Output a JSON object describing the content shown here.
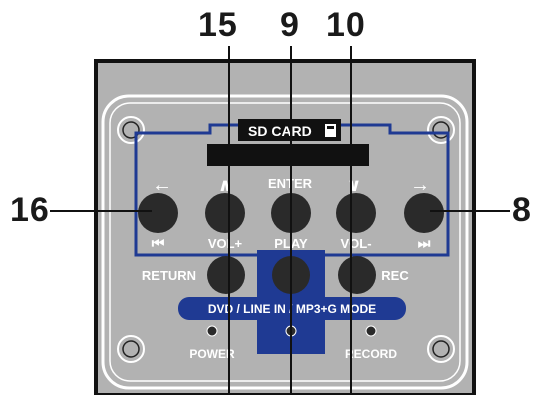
{
  "callouts": {
    "c15": "15",
    "c9": "9",
    "c10": "10",
    "c16": "16",
    "c8": "8"
  },
  "panel": {
    "sd_card_label": "SD CARD",
    "top_labels": {
      "left_arrow": "←",
      "up_arrow": "∧",
      "enter": "ENTER",
      "down_arrow": "∨",
      "right_arrow": "→"
    },
    "bottom_labels": {
      "prev": "⏮",
      "vol_plus": "VOL+",
      "play": "PLAY",
      "vol_minus": "VOL-",
      "next": "⏭"
    },
    "return_label": "RETURN",
    "rec_label": "REC",
    "mode_label": "DVD / LINE IN / MP3+G MODE",
    "power_label": "POWER",
    "record_label": "RECORD"
  },
  "colors": {
    "panel_fill": "#b2b2b2",
    "panel_border": "#111111",
    "accent_blue": "#1f3a93",
    "button_fill": "#2a2a2a",
    "white_text": "#ffffff"
  }
}
